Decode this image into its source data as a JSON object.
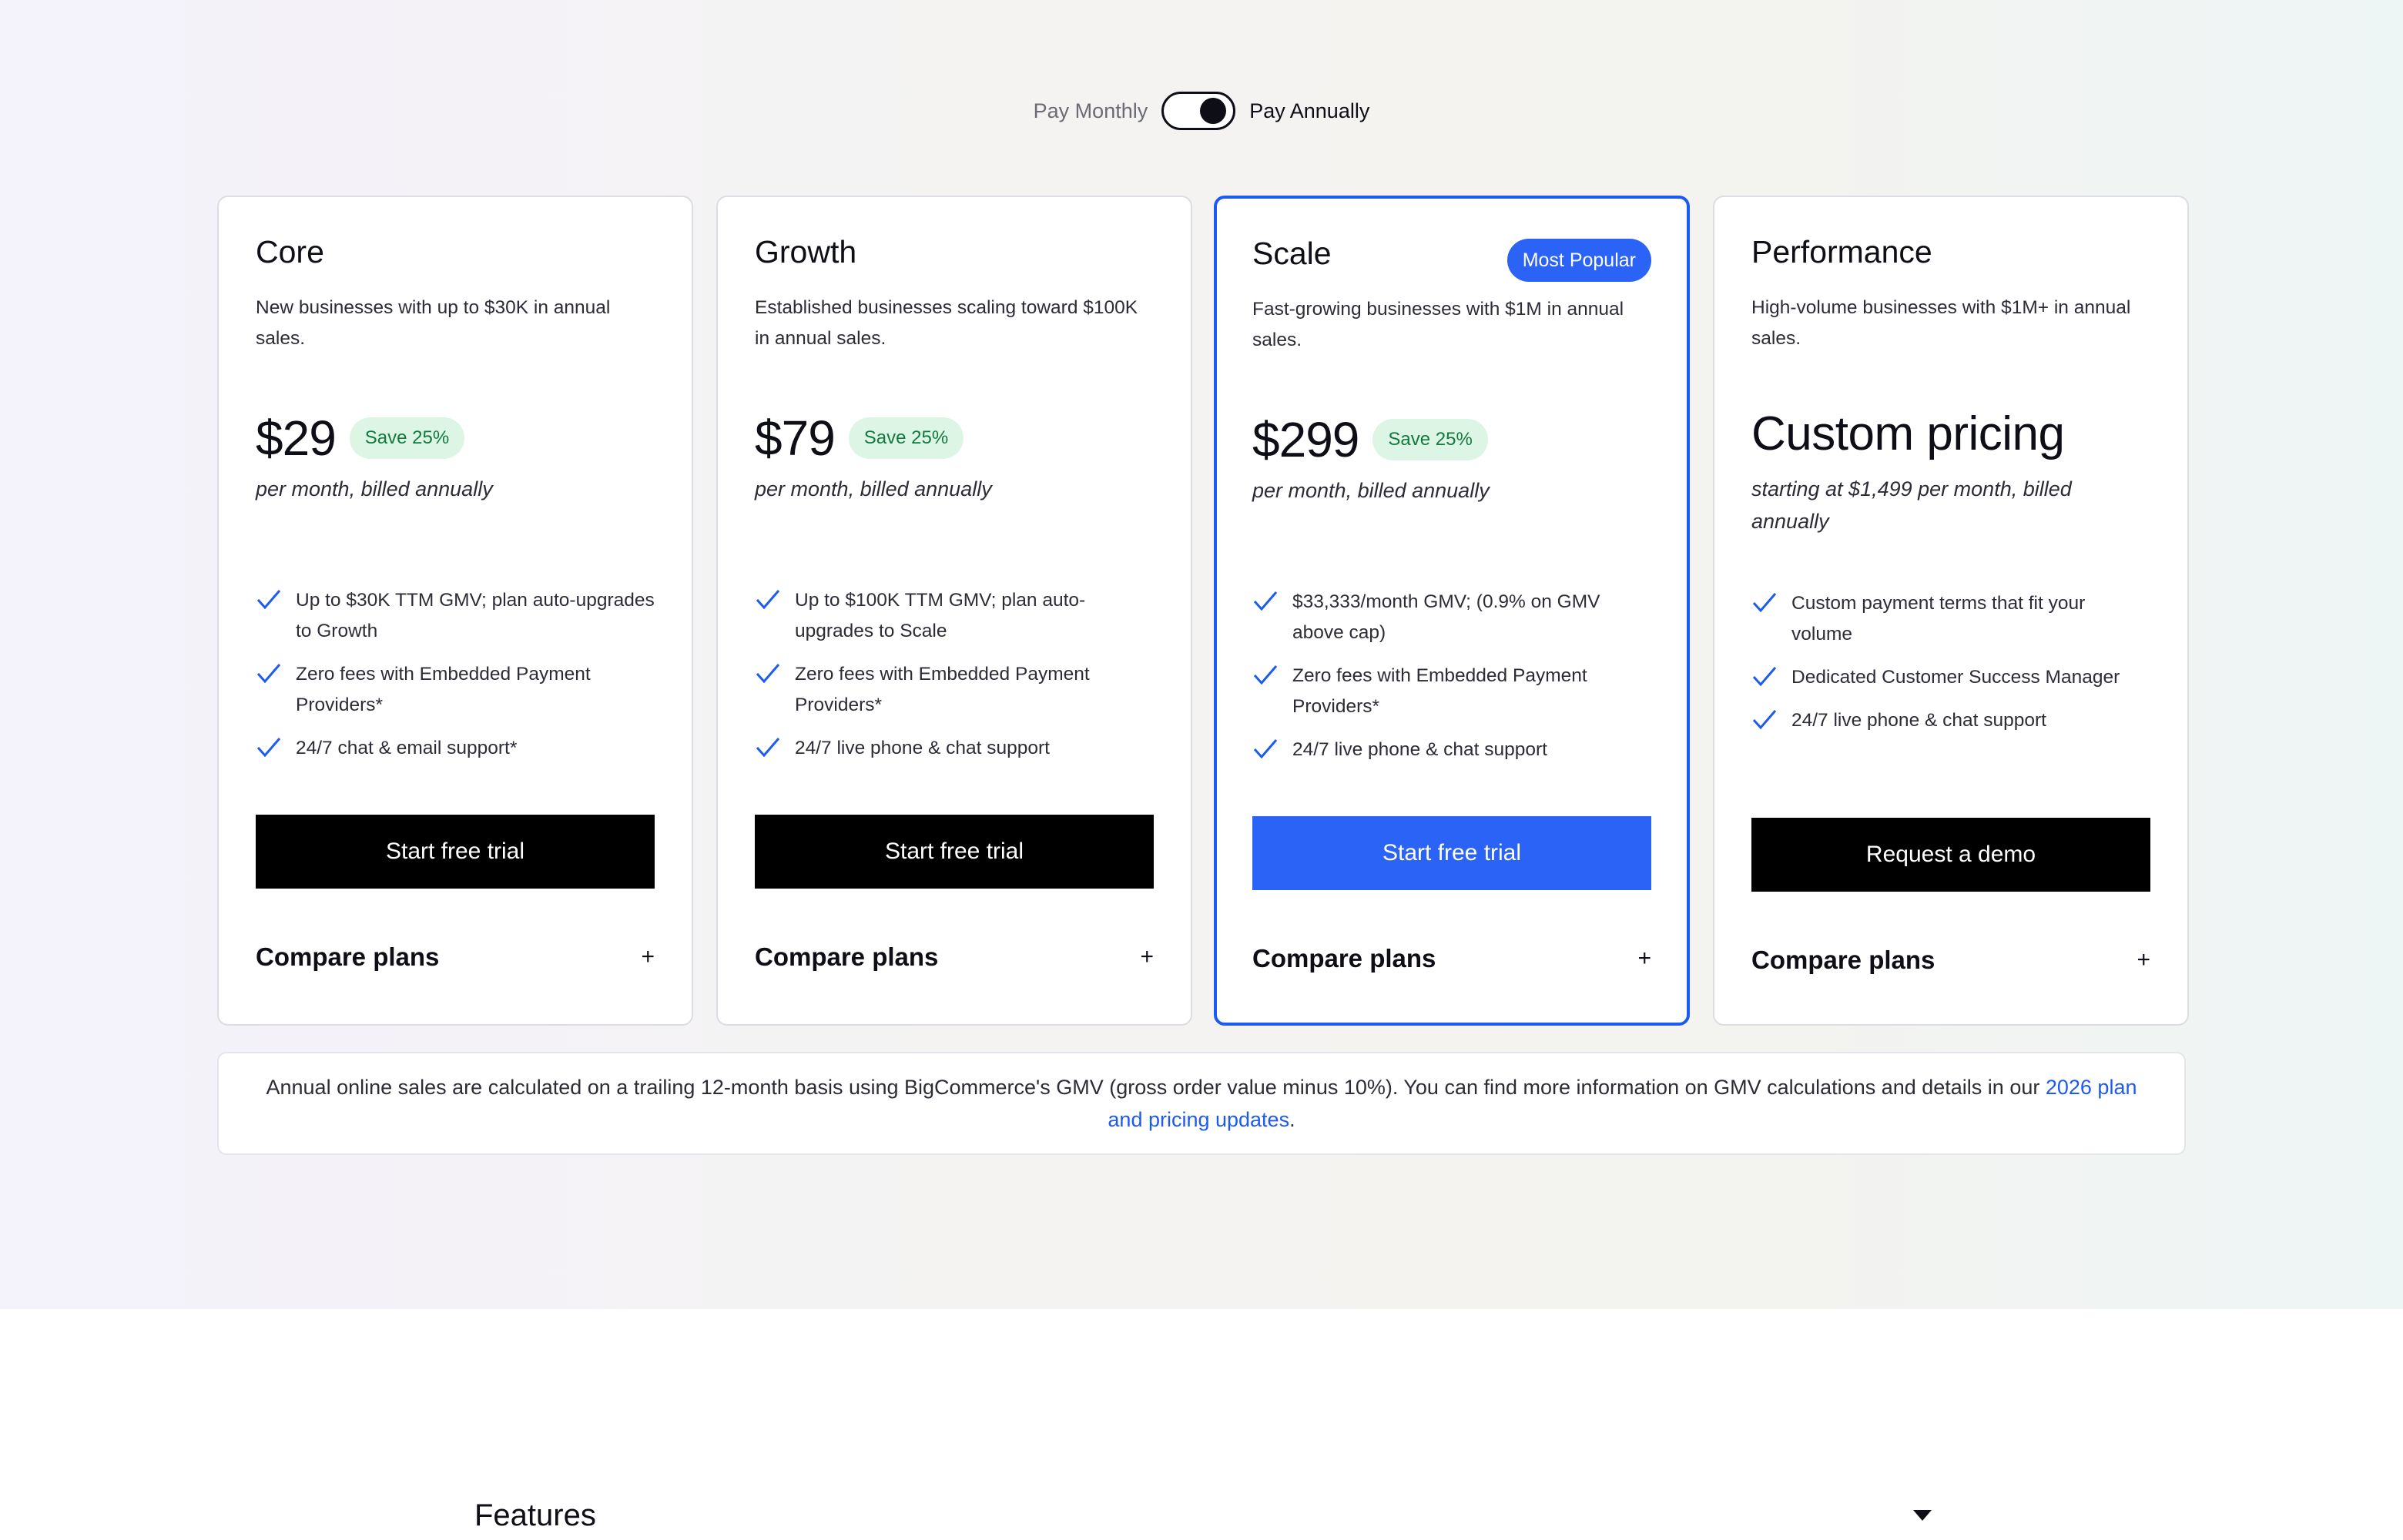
{
  "billing_toggle": {
    "monthly_label": "Pay Monthly",
    "annual_label": "Pay Annually",
    "selected": "annual"
  },
  "plans": [
    {
      "name": "Core",
      "description": "New businesses with up to $30K in annual sales.",
      "price": "$29",
      "save_badge": "Save 25%",
      "billing_note": "per month, billed annually",
      "features": [
        "Up to $30K TTM GMV; plan auto-upgrades to Growth",
        "Zero fees with Embedded Payment Providers*",
        "24/7 chat & email support*"
      ],
      "cta": "Start free trial",
      "compare": "Compare plans",
      "compare_icon": "+"
    },
    {
      "name": "Growth",
      "description": "Established businesses scaling toward $100K in annual sales.",
      "price": "$79",
      "save_badge": "Save 25%",
      "billing_note": "per month, billed annually",
      "features": [
        "Up to $100K TTM GMV; plan auto-upgrades to Scale",
        "Zero fees with Embedded Payment Providers*",
        "24/7 live phone & chat support"
      ],
      "cta": "Start free trial",
      "compare": "Compare plans",
      "compare_icon": "+"
    },
    {
      "name": "Scale",
      "badge": "Most Popular",
      "description": "Fast-growing businesses with $1M in annual sales.",
      "price": "$299",
      "save_badge": "Save 25%",
      "billing_note": "per month, billed annually",
      "features": [
        "$33,333/month GMV; (0.9% on GMV above cap)",
        "Zero fees with Embedded Payment Providers*",
        "24/7 live phone & chat support"
      ],
      "cta": "Start free trial",
      "compare": "Compare plans",
      "compare_icon": "+"
    },
    {
      "name": "Performance",
      "description": "High-volume businesses with $1M+ in annual sales.",
      "price": "Custom pricing",
      "billing_note": "starting at $1,499 per month, billed annually",
      "features": [
        "Custom payment terms that fit your volume",
        "Dedicated Customer Success Manager",
        "24/7 live phone & chat support"
      ],
      "cta": "Request a demo",
      "compare": "Compare plans",
      "compare_icon": "+"
    }
  ],
  "footnote": {
    "text": "Annual online sales are calculated on a trailing 12-month basis using BigCommerce's GMV (gross order value minus 10%). You can find more information on GMV calculations and details in our ",
    "link_text": "2026 plan and pricing updates",
    "suffix": "."
  },
  "features_section": {
    "title": "Features"
  },
  "colors": {
    "accent_blue": "#2a63f5",
    "save_badge_bg": "#ddf5e5",
    "save_badge_text": "#137a3f",
    "cta_black": "#000000"
  },
  "icons": {
    "feature_bullet": "check-icon",
    "features_toggle": "caret-down-icon"
  }
}
